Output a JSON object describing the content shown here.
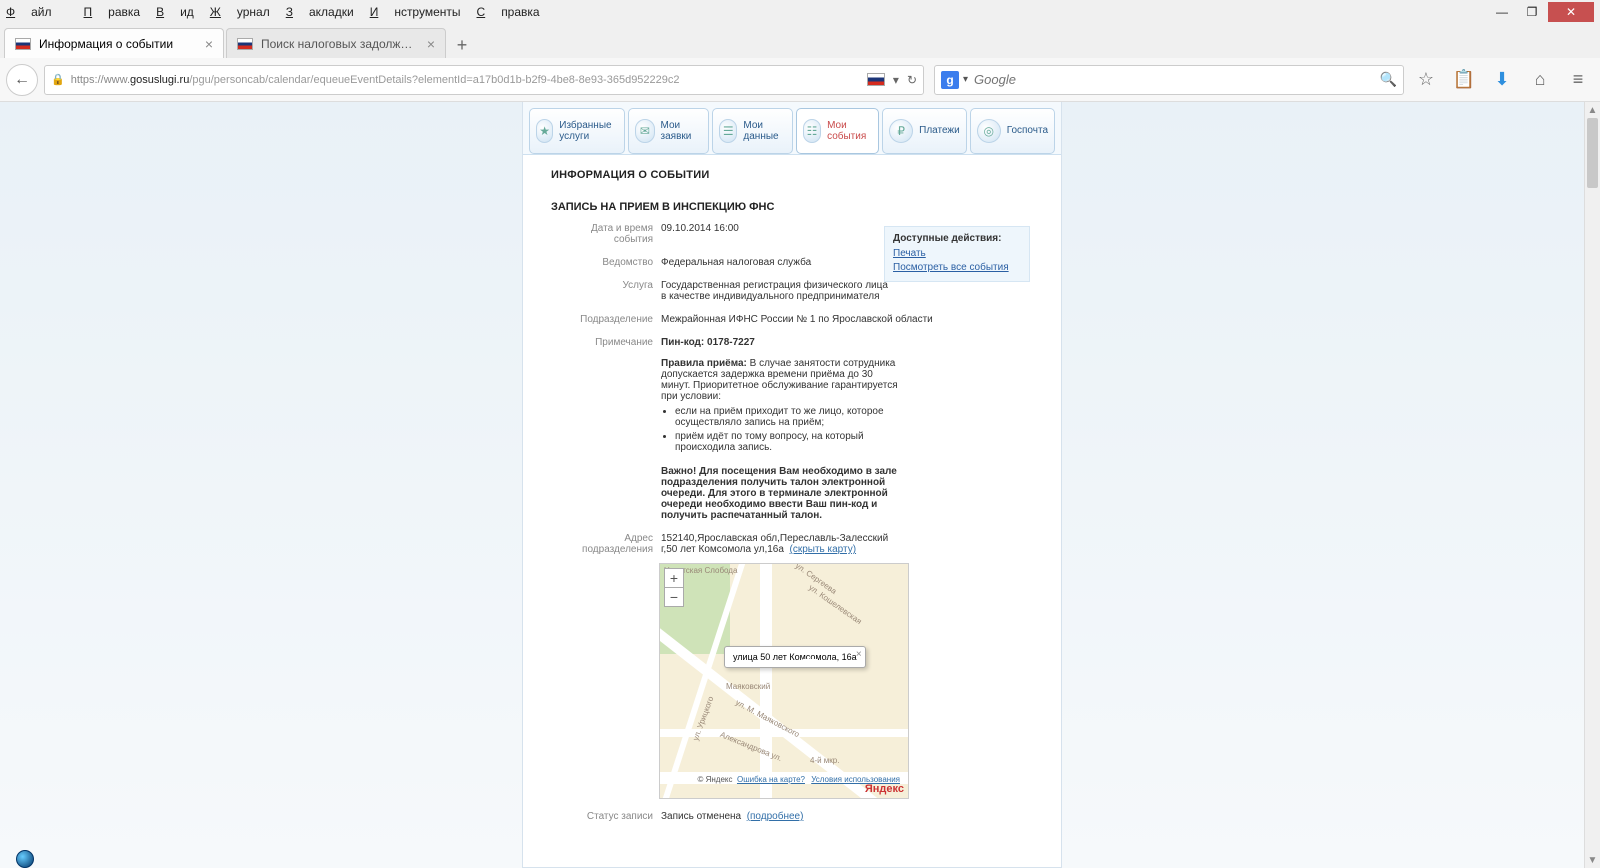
{
  "menubar": [
    "Файл",
    "Правка",
    "Вид",
    "Журнал",
    "Закладки",
    "Инструменты",
    "Справка"
  ],
  "tabs": [
    {
      "title": "Информация о событии",
      "active": true
    },
    {
      "title": "Поиск налоговых задолж…",
      "active": false
    }
  ],
  "url": {
    "scheme": "https://www.",
    "host": "gosuslugi.ru",
    "path": "/pgu/personcab/calendar/equeueEventDetails?elementId=a17b0d1b-b2f9-4be8-8e93-365d952229c2"
  },
  "search_placeholder": "Google",
  "cabtabs": [
    {
      "label": "Избранные услуги"
    },
    {
      "label": "Мои заявки"
    },
    {
      "label": "Мои данные"
    },
    {
      "label": "Мои события",
      "active": true
    },
    {
      "label": "Платежи"
    },
    {
      "label": "Госпочта"
    }
  ],
  "page": {
    "h1": "ИНФОРМАЦИЯ О СОБЫТИИ",
    "h2": "ЗАПИСЬ НА ПРИЕМ В ИНСПЕКЦИЮ ФНС"
  },
  "labels": {
    "datetime": "Дата и время события",
    "agency": "Ведомство",
    "service": "Услуга",
    "division": "Подразделение",
    "note": "Примечание",
    "rules": "Правила приёма:",
    "important": "Важно! Для посещения Вам необходимо в зале подразделения получить талон электронной очереди. Для этого в терминале электронной очереди необходимо ввести Ваш пин-код и получить распечатанный талон.",
    "address": "Адрес подразделения",
    "hidemap": "(скрыть карту)",
    "status": "Статус записи",
    "more": "(подробнее)"
  },
  "values": {
    "datetime": "09.10.2014 16:00",
    "agency": "Федеральная налоговая служба",
    "service": "Государственная регистрация физического лица в качестве индивидуального предпринимателя",
    "division": "Межрайонная ИФНС России № 1 по Ярославской области",
    "pin": "Пин-код: 0178-7227",
    "rules_text": "В случае занятости сотрудника допускается задержка времени приёма до 30 минут. Приоритетное обслуживание гарантируется при условии:",
    "rule1": "если на приём приходит то же лицо, которое осуществляло запись на приём;",
    "rule2": "приём идёт по тому вопросу, на который происходила запись.",
    "address": "152140,Ярославская обл,Переславль-Залесский г,50 лет Комсомола ул,16а",
    "status": "Запись отменена"
  },
  "actions": {
    "header": "Доступные действия:",
    "print": "Печать",
    "all": "Посмотреть все события"
  },
  "map": {
    "balloon": "улица 50 лет Комсомола, 16а",
    "streets": [
      "ул. Сергеева",
      "ул. Кошелевская",
      "Маяковский",
      "ул. М. Маяковского",
      "Александрова ул.",
      "4-й мкр.",
      "ул. Урицкого",
      "Никитская Слобода"
    ],
    "copyright": "© Яндекс",
    "err": "Ошибка на карте?",
    "terms": "Условия использования",
    "brand": "Яндекс"
  }
}
